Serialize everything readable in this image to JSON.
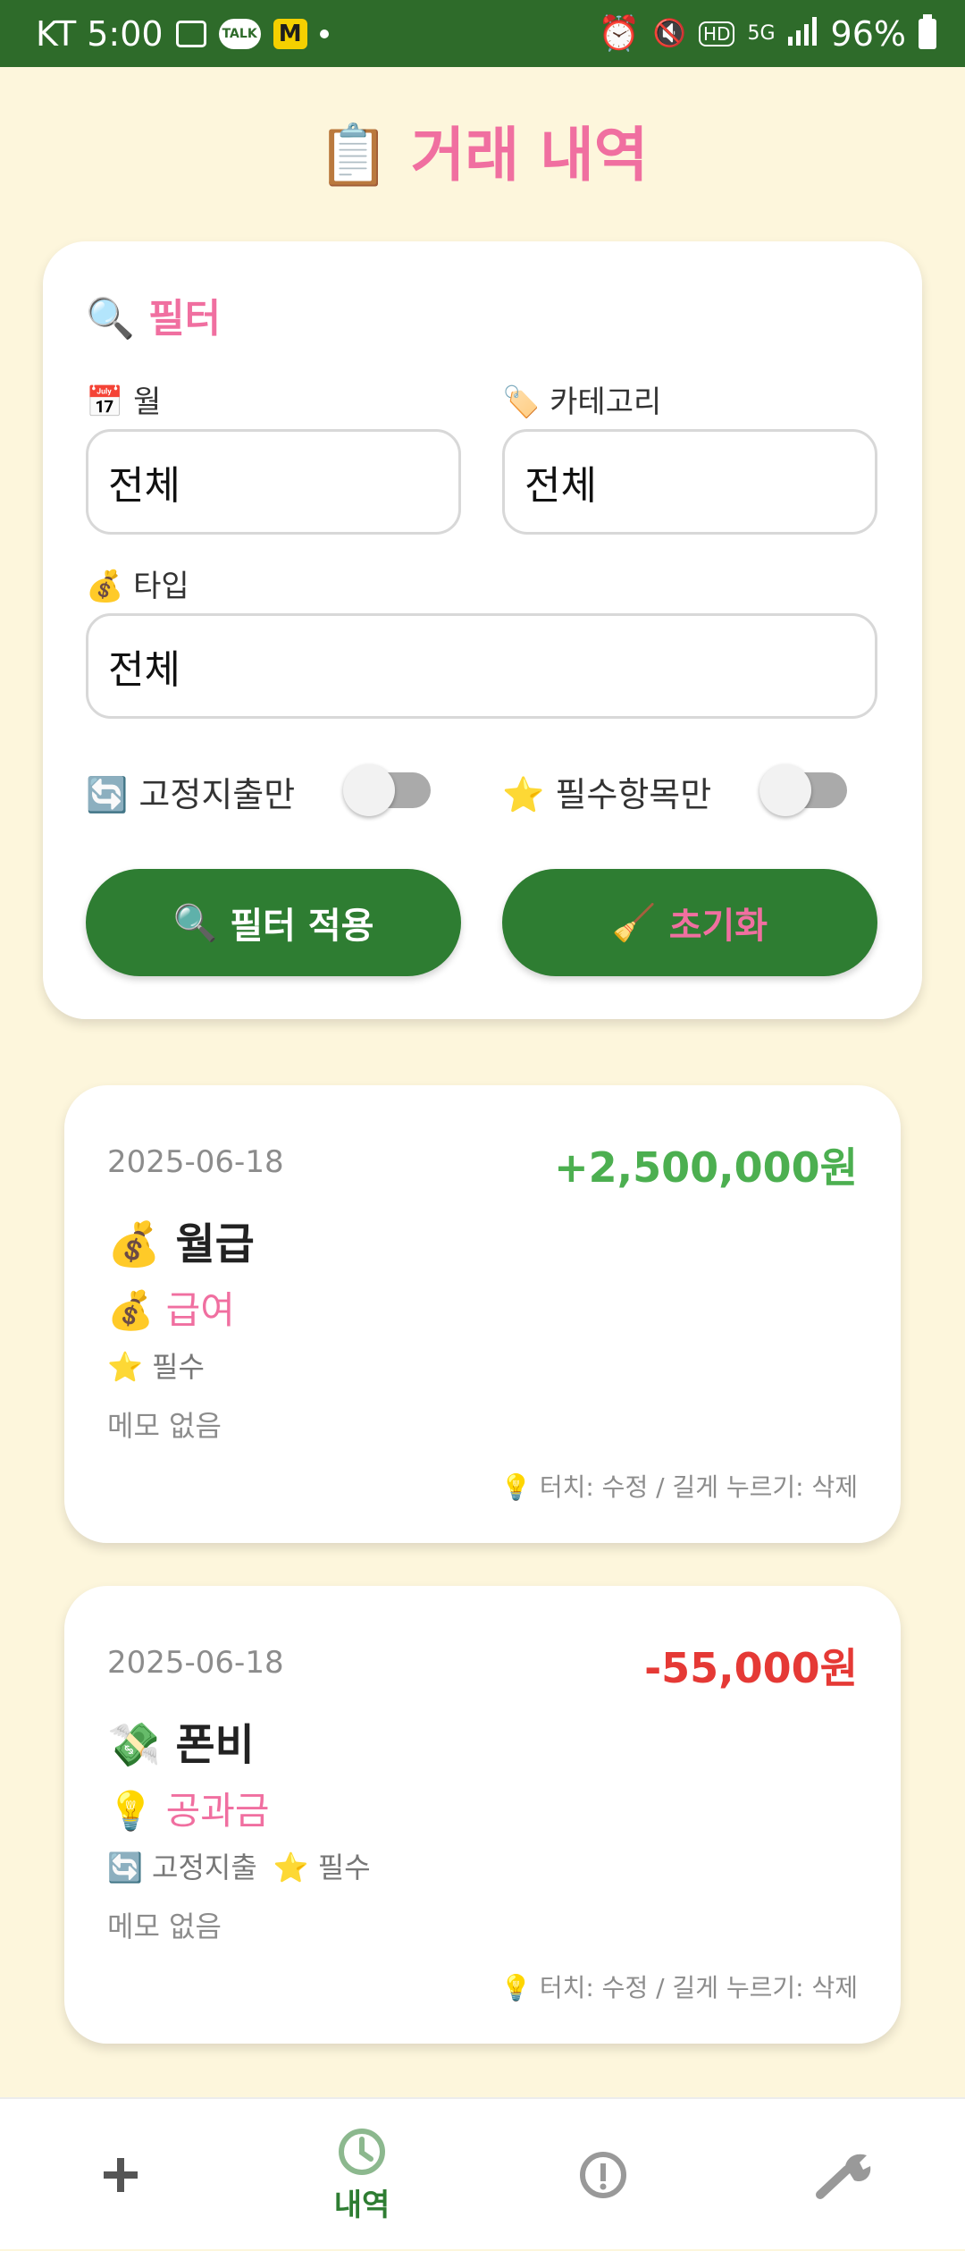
{
  "status_bar": {
    "carrier_time": "KT 5:00",
    "talk_label": "TALK",
    "m_label": "M",
    "network": "5G",
    "hd": "HD",
    "battery": "96%"
  },
  "page": {
    "title_icon": "📋",
    "title": "거래 내역"
  },
  "filter": {
    "heading_icon": "🔍",
    "heading": "필터",
    "month": {
      "icon": "📅",
      "label": "월",
      "value": "전체"
    },
    "category": {
      "icon": "🏷️",
      "label": "카테고리",
      "value": "전체"
    },
    "type": {
      "icon": "💰",
      "label": "타입",
      "value": "전체"
    },
    "fixed_only": {
      "icon": "🔄",
      "label": "고정지출만",
      "on": false
    },
    "essential_only": {
      "icon": "⭐",
      "label": "필수항목만",
      "on": false
    },
    "apply_button": {
      "icon": "🔍",
      "label": "필터 적용"
    },
    "reset_button": {
      "icon": "🧹",
      "label": "초기화"
    }
  },
  "transactions": [
    {
      "date": "2025-06-18",
      "amount": "+2,500,000원",
      "amount_color": "#4caf50",
      "title_icon": "💰",
      "title": "월급",
      "category_icon": "💰",
      "category": "급여",
      "tags": [
        {
          "icon": "⭐",
          "label": "필수"
        }
      ],
      "memo": "메모 없음",
      "hint": "💡 터치: 수정 / 길게 누르기: 삭제"
    },
    {
      "date": "2025-06-18",
      "amount": "-55,000원",
      "amount_color": "#e53935",
      "title_icon": "💸",
      "title": "폰비",
      "category_icon": "💡",
      "category": "공과금",
      "tags": [
        {
          "icon": "🔄",
          "label": "고정지출"
        },
        {
          "icon": "⭐",
          "label": "필수"
        }
      ],
      "memo": "메모 없음",
      "hint": "💡 터치: 수정 / 길게 누르기: 삭제"
    }
  ],
  "bottom_nav": {
    "items": [
      {
        "icon": "plus-icon",
        "label": ""
      },
      {
        "icon": "clock-icon",
        "label": "내역",
        "active": true
      },
      {
        "icon": "info-icon",
        "label": ""
      },
      {
        "icon": "wrench-icon",
        "label": ""
      }
    ]
  },
  "colors": {
    "brand_green": "#2e7d32",
    "status_bar": "#2e6b2a",
    "accent_pink": "#f06fa0",
    "background": "#fdf6dc"
  }
}
